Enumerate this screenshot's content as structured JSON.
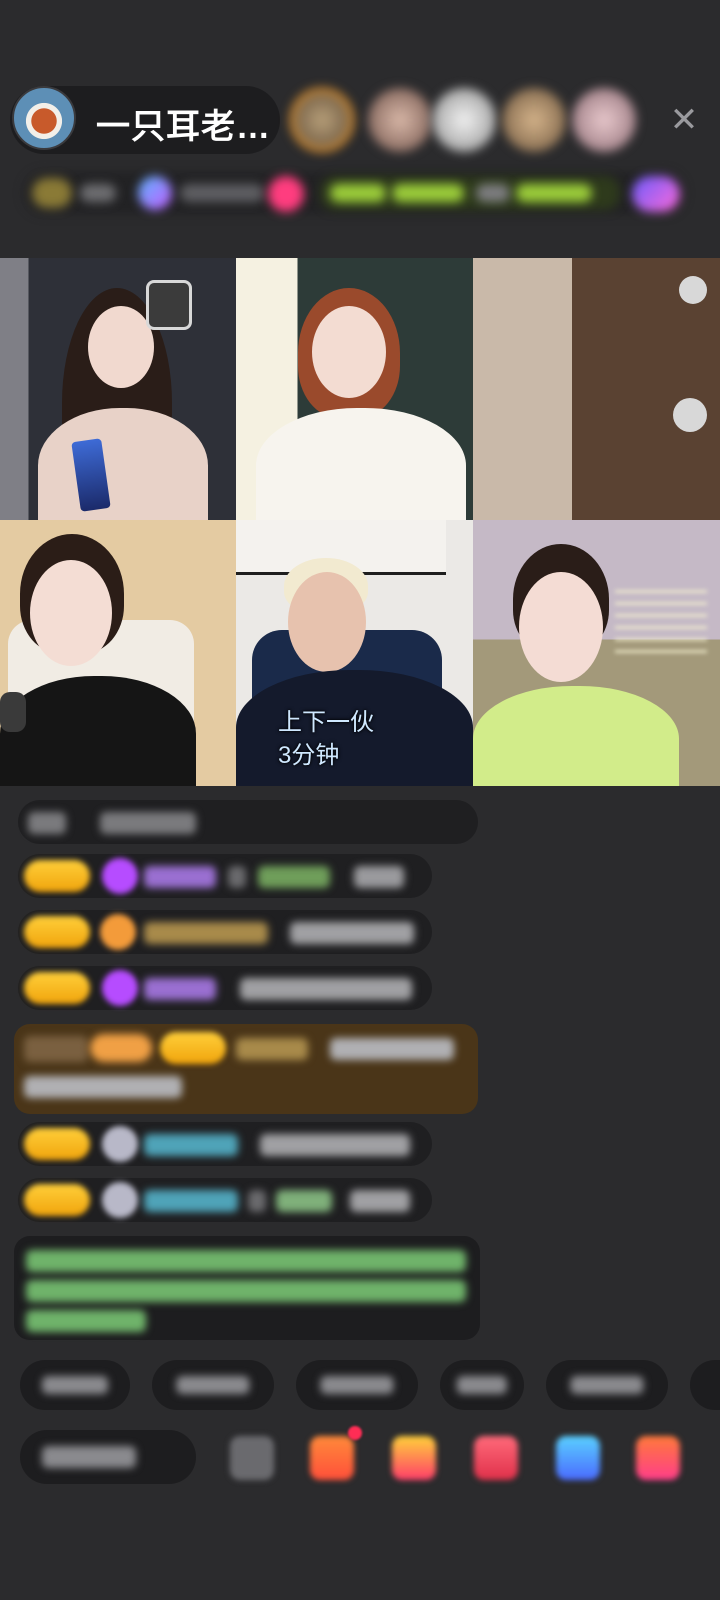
{
  "header": {
    "host_name": "一只耳老…",
    "close_glyph": "✕"
  },
  "video": {
    "caption_line1": "上下一伙",
    "caption_line2": "3分钟"
  },
  "colors": {
    "background": "#2b2b2d",
    "badge_gold": "#f0a40c",
    "chat_row": "#1f1f21",
    "gift_bar": "#4a3518"
  }
}
